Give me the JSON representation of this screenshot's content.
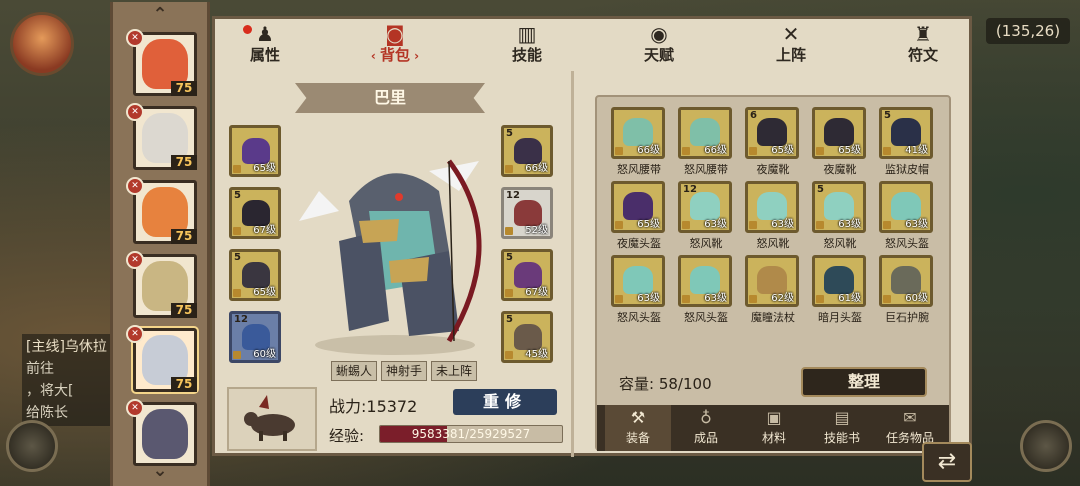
{
  "hud": {
    "coords": "(135,26)",
    "quest_line1": "[主线]乌休拉",
    "quest_line2": "前往",
    "quest_line3": "，将大[",
    "quest_line4": "给陈长"
  },
  "roster": {
    "heroes": [
      {
        "level": "75",
        "face": "#e0603a",
        "class_icon": "sword-icon"
      },
      {
        "level": "75",
        "face": "#dcd8d0",
        "class_icon": "sword-icon"
      },
      {
        "level": "75",
        "face": "#e7823e",
        "class_icon": "bow-icon"
      },
      {
        "level": "75",
        "face": "#c9b683",
        "class_icon": "sword-icon"
      },
      {
        "level": "75",
        "face": "#c7ccd6",
        "class_icon": "sword-icon"
      },
      {
        "level": "",
        "face": "#5a5870",
        "class_icon": "sword-icon"
      }
    ]
  },
  "tabs": [
    {
      "label": "属性",
      "icon": "attributes-icon",
      "glyph": "♟",
      "badge": true
    },
    {
      "label": "背包",
      "icon": "backpack-icon",
      "glyph": "◙",
      "active": true
    },
    {
      "label": "技能",
      "icon": "skill-book-icon",
      "glyph": "▥"
    },
    {
      "label": "天赋",
      "icon": "talent-eye-icon",
      "glyph": "◉"
    },
    {
      "label": "上阵",
      "icon": "crossed-swords-icon",
      "glyph": "✕"
    },
    {
      "label": "符文",
      "icon": "rune-icon",
      "glyph": "♜"
    }
  ],
  "hero": {
    "name": "巴里",
    "tags": [
      "蜥蜴人",
      "神射手",
      "未上阵"
    ],
    "power_label": "战力:15372",
    "rebuild_label": "重修",
    "exp_label": "经验:",
    "exp_text": "9583381/25929527",
    "exp_fraction": 0.3696
  },
  "equip_left": [
    {
      "lv": "65级",
      "count": "",
      "color": "#5a3a8a",
      "style": "gold"
    },
    {
      "lv": "67级",
      "count": "5",
      "color": "#2a2630",
      "style": "gold"
    },
    {
      "lv": "65级",
      "count": "5",
      "color": "#3a3640",
      "style": "gold"
    },
    {
      "lv": "60级",
      "count": "12",
      "color": "#3a5a9a",
      "style": "blue"
    }
  ],
  "equip_right": [
    {
      "lv": "66级",
      "count": "5",
      "color": "#3a3048",
      "style": "gold"
    },
    {
      "lv": "52级",
      "count": "12",
      "color": "#8a3a3a",
      "style": "light"
    },
    {
      "lv": "67级",
      "count": "5",
      "color": "#6a3a7a",
      "style": "gold"
    },
    {
      "lv": "45级",
      "count": "5",
      "color": "#6a5a4a",
      "style": "gold"
    }
  ],
  "inventory": {
    "items": [
      {
        "name": "怒风腰带",
        "lv": "66级",
        "count": "",
        "color": "#7fbfa8"
      },
      {
        "name": "怒风腰带",
        "lv": "66级",
        "count": "",
        "color": "#7fbfa8"
      },
      {
        "name": "夜魔靴",
        "lv": "65级",
        "count": "6",
        "color": "#2e2a34"
      },
      {
        "name": "夜魔靴",
        "lv": "65级",
        "count": "",
        "color": "#2e2a34"
      },
      {
        "name": "监狱皮帽",
        "lv": "41级",
        "count": "5",
        "color": "#2a3048"
      },
      {
        "name": "夜魔头盔",
        "lv": "65级",
        "count": "",
        "color": "#4a2e6a"
      },
      {
        "name": "怒风靴",
        "lv": "63级",
        "count": "12",
        "color": "#8fd0c0"
      },
      {
        "name": "怒风靴",
        "lv": "63级",
        "count": "",
        "color": "#8fd0c0"
      },
      {
        "name": "怒风靴",
        "lv": "63级",
        "count": "5",
        "color": "#8fd0c0"
      },
      {
        "name": "怒风头盔",
        "lv": "63级",
        "count": "",
        "color": "#7fc8b8"
      },
      {
        "name": "怒风头盔",
        "lv": "63级",
        "count": "",
        "color": "#7fc8b8"
      },
      {
        "name": "怒风头盔",
        "lv": "63级",
        "count": "",
        "color": "#7fc8b8"
      },
      {
        "name": "魔瞳法杖",
        "lv": "62级",
        "count": "",
        "color": "#b08a4a"
      },
      {
        "name": "暗月头盔",
        "lv": "61级",
        "count": "",
        "color": "#2e4a58"
      },
      {
        "name": "巨石护腕",
        "lv": "60级",
        "count": "",
        "color": "#6a6a5a"
      }
    ],
    "capacity_label": "容量:",
    "capacity_value": "58/100",
    "sort_label": "整理"
  },
  "categories": [
    {
      "label": "装备",
      "icon": "equipment-hammer-icon",
      "glyph": "⚒",
      "active": true
    },
    {
      "label": "成品",
      "icon": "product-bag-icon",
      "glyph": "♁"
    },
    {
      "label": "材料",
      "icon": "material-icon",
      "glyph": "▣"
    },
    {
      "label": "技能书",
      "icon": "skill-scroll-icon",
      "glyph": "▤"
    },
    {
      "label": "任务物品",
      "icon": "quest-item-icon",
      "glyph": "✉"
    }
  ]
}
